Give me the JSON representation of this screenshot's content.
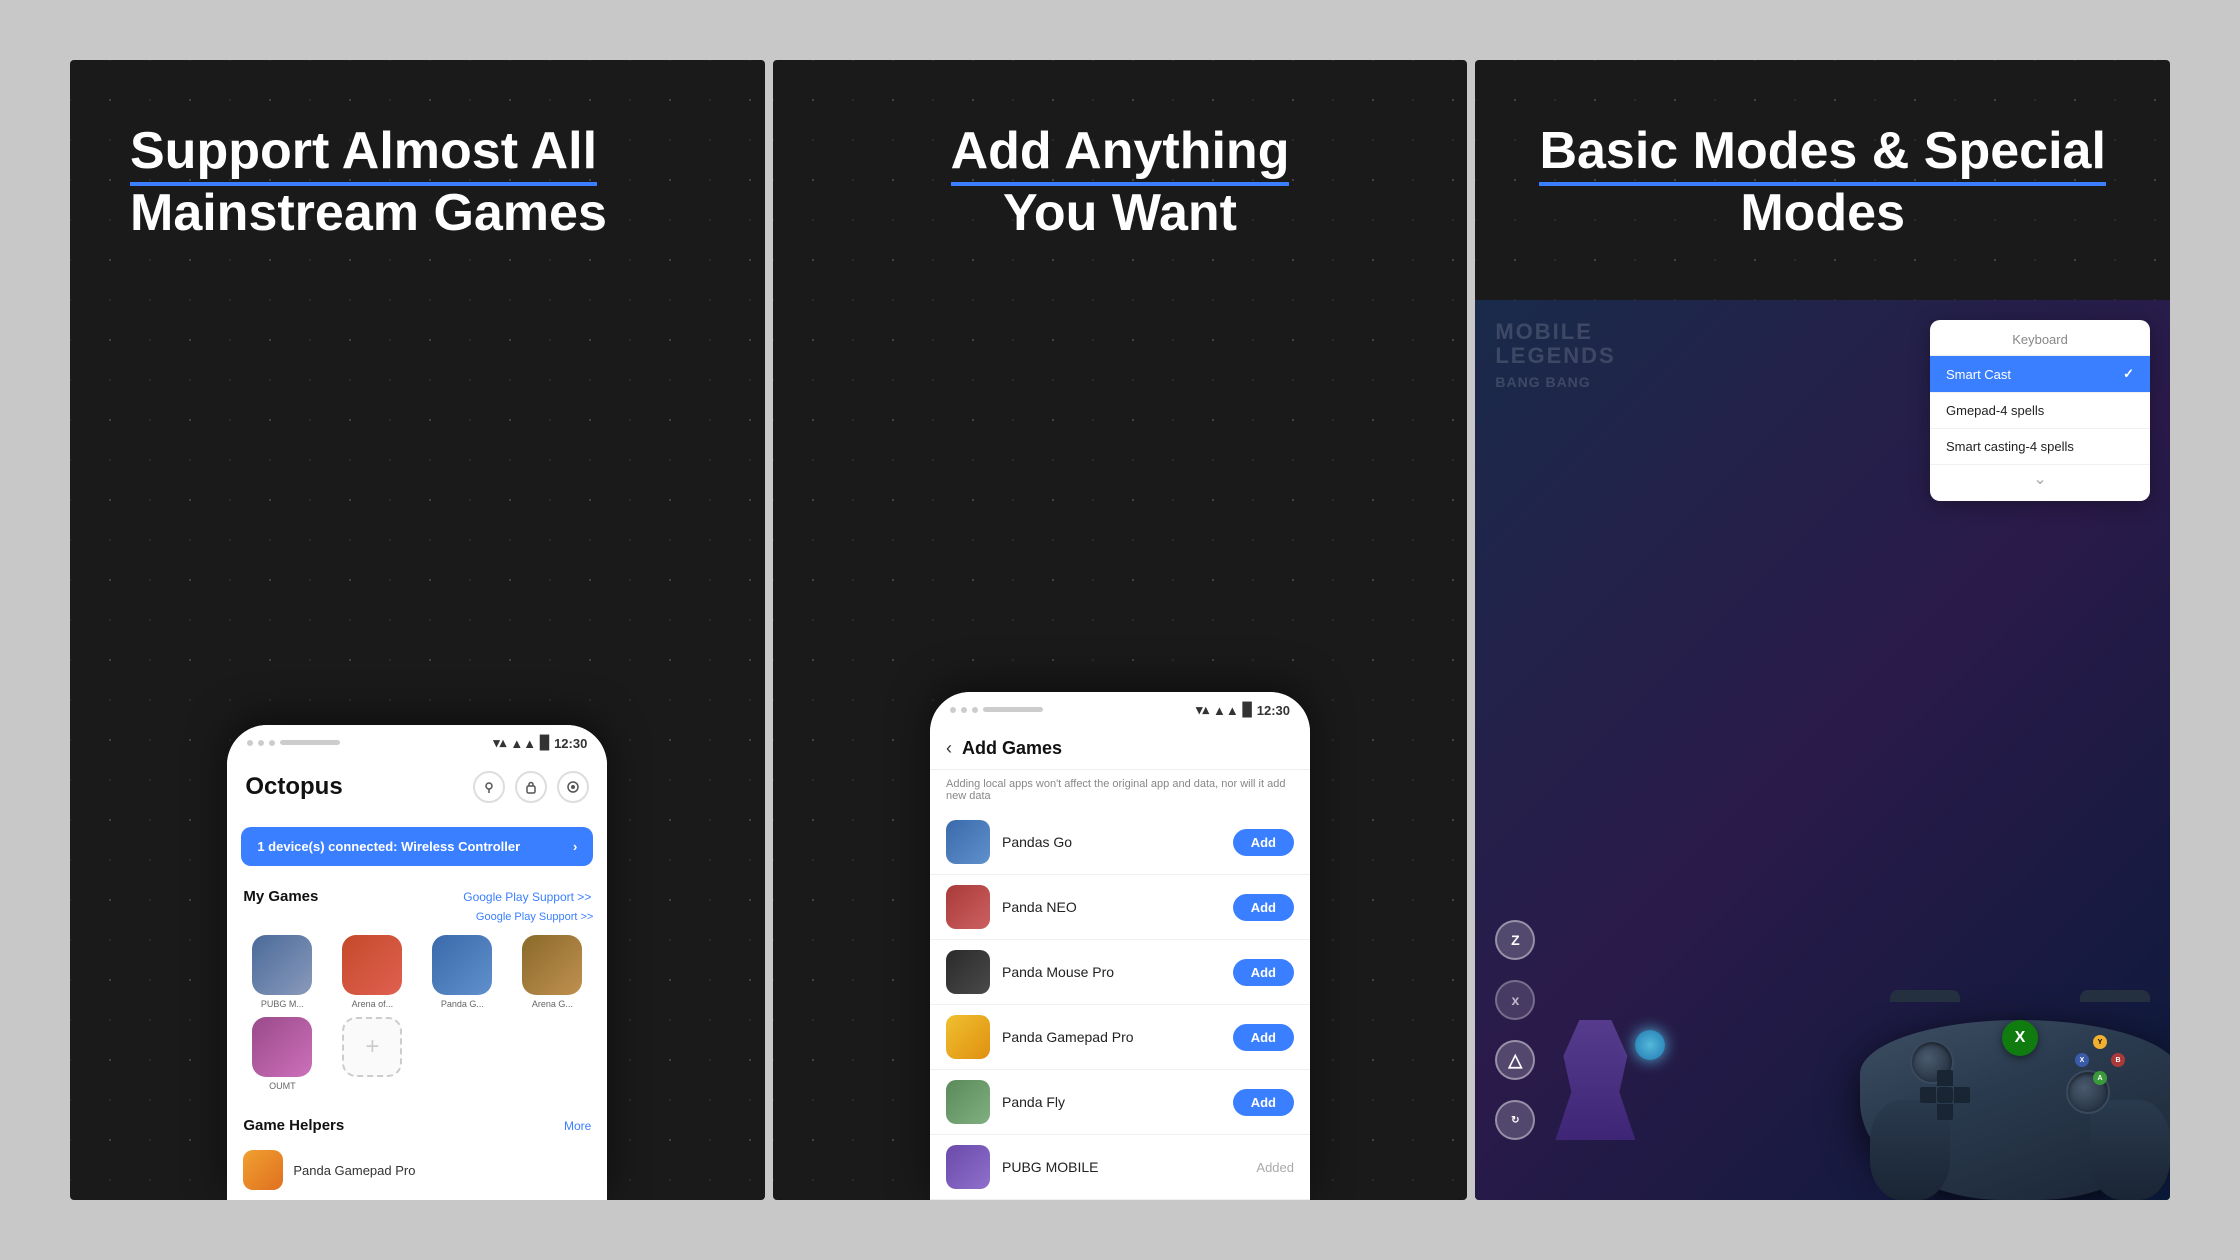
{
  "background": "#c8c8c8",
  "panels": [
    {
      "id": "panel-1",
      "title_line1": "Support Almost All",
      "title_line2": "Mainstream Games",
      "title_underline": "Support Almost All",
      "phone": {
        "time": "12:30",
        "app_name": "Octopus",
        "connected_text": "1 device(s) connected: Wireless Controller",
        "my_games_label": "My Games",
        "google_play_label": "Google Play Support >>",
        "games": [
          {
            "label": "PUBG M...",
            "color": "gi-1"
          },
          {
            "label": "Arena of...",
            "color": "gi-2"
          },
          {
            "label": "Panda G...",
            "color": "gi-3"
          },
          {
            "label": "Arena G...",
            "color": "gi-4"
          }
        ],
        "games_row2": [
          {
            "label": "OUMT",
            "color": "gi-5"
          }
        ],
        "game_helpers_label": "Game Helpers",
        "more_label": "More",
        "helper_name": "Panda Gamepad Pro"
      }
    },
    {
      "id": "panel-2",
      "title_line1": "Add Anything",
      "title_line2": "You Want",
      "phone": {
        "time": "12:30",
        "add_games_title": "Add Games",
        "add_note": "Adding local apps won't affect the original app and data, nor will it add new data",
        "games": [
          {
            "name": "Pandas Go",
            "color": "gli-1",
            "action": "Add"
          },
          {
            "name": "Panda NEO",
            "color": "gli-2",
            "action": "Add"
          },
          {
            "name": "Panda Mouse Pro",
            "color": "gli-3",
            "action": "Add"
          },
          {
            "name": "Panda Gamepad Pro",
            "color": "gli-4",
            "action": "Add"
          },
          {
            "name": "Panda Fly",
            "color": "gli-5",
            "action": "Add"
          },
          {
            "name": "PUBG MOBILE",
            "color": "gli-6",
            "action": "Added"
          }
        ]
      }
    },
    {
      "id": "panel-3",
      "title_line1": "Basic Modes & Special",
      "title_line2": "Modes",
      "game": {
        "bg_game_name": "MOBILE\nLEGENDS",
        "keyboard_label": "Keyboard",
        "modes": [
          {
            "label": "Smart Cast",
            "active": true
          },
          {
            "label": "Gmepad-4 spells",
            "active": false
          },
          {
            "label": "Smart casting-4 spells",
            "active": false
          }
        ],
        "check_icon": "✓",
        "controller_brand": "X"
      }
    }
  ],
  "icons": {
    "back_arrow": "‹",
    "chevron_right": "›",
    "chevron_down": "⌄",
    "wifi": "▼▲",
    "signal": "▲▲▲",
    "battery": "▉",
    "location": "⊙",
    "lock": "⊜",
    "record": "⊕",
    "check": "✓",
    "plus": "+"
  }
}
